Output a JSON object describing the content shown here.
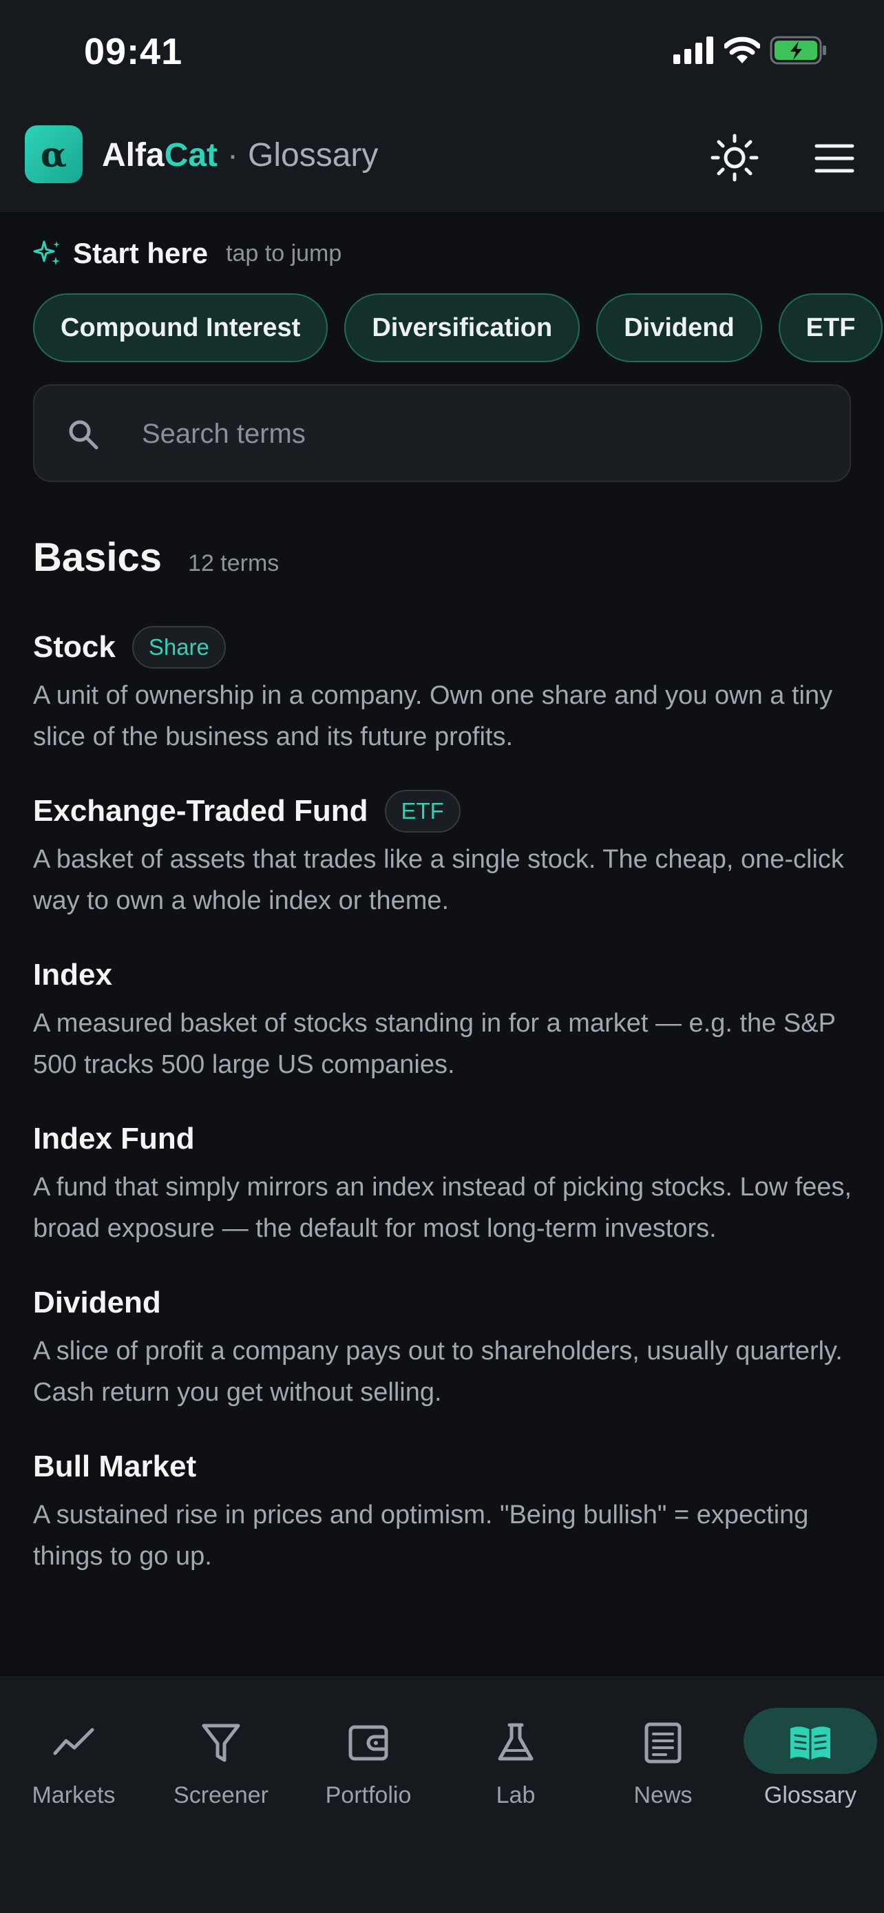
{
  "status_bar": {
    "time": "09:41"
  },
  "header": {
    "logo_letter": "α",
    "brand_part1": "Alfa",
    "brand_part2": "Cat",
    "separator": "·",
    "section": "Glossary",
    "accent_color": "#2ed3b7"
  },
  "start_here": {
    "title": "Start here",
    "hint": "tap to jump",
    "chips": [
      "Compound Interest",
      "Diversification",
      "Dividend",
      "ETF"
    ]
  },
  "search": {
    "placeholder": "Search terms",
    "value": ""
  },
  "section": {
    "title": "Basics",
    "count": "12 terms"
  },
  "terms": [
    {
      "name": "Stock",
      "tag": "Share",
      "desc": "A unit of ownership in a company. Own one share and you own a tiny slice of the business and its future profits."
    },
    {
      "name": "Exchange-Traded Fund",
      "tag": "ETF",
      "desc": "A basket of assets that trades like a single stock. The cheap, one-click way to own a whole index or theme."
    },
    {
      "name": "Index",
      "tag": "",
      "desc": "A measured basket of stocks standing in for a market — e.g. the S&P 500 tracks 500 large US companies."
    },
    {
      "name": "Index Fund",
      "tag": "",
      "desc": "A fund that simply mirrors an index instead of picking stocks. Low fees, broad exposure — the default for most long-term investors."
    },
    {
      "name": "Dividend",
      "tag": "",
      "desc": "A slice of profit a company pays out to shareholders, usually quarterly. Cash return you get without selling."
    },
    {
      "name": "Bull Market",
      "tag": "",
      "desc": "A sustained rise in prices and optimism. \"Being bullish\" = expecting things to go up."
    }
  ],
  "nav": {
    "items": [
      {
        "label": "Markets",
        "icon": "trend-line-icon"
      },
      {
        "label": "Screener",
        "icon": "filter-icon"
      },
      {
        "label": "Portfolio",
        "icon": "wallet-icon"
      },
      {
        "label": "Lab",
        "icon": "flask-icon"
      },
      {
        "label": "News",
        "icon": "newspaper-icon"
      },
      {
        "label": "Glossary",
        "icon": "book-icon"
      }
    ],
    "active": "Glossary"
  }
}
